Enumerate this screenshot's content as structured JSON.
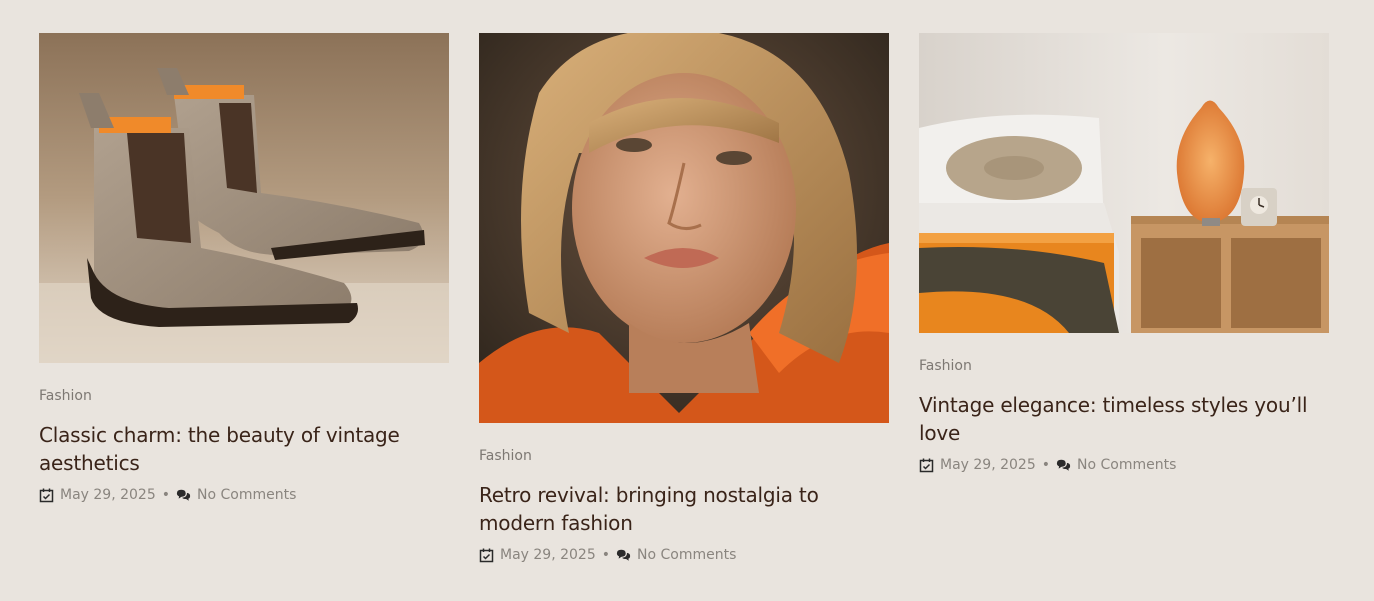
{
  "posts": [
    {
      "image": "suede chelsea boots on carpet",
      "category": "Fashion",
      "title": "Classic charm: the beauty of vintage aesthetics",
      "date": "May 29, 2025",
      "separator": "•",
      "comments": "No Comments"
    },
    {
      "image": "portrait of woman with blonde hair in orange jacket",
      "category": "Fashion",
      "title": "Retro revival: bringing nostalgia to modern fashion",
      "date": "May 29, 2025",
      "separator": "•",
      "comments": "No Comments"
    },
    {
      "image": "bedroom with rattan lamp and nightstand",
      "category": "Fashion",
      "title": "Vintage elegance: timeless styles you’ll love",
      "date": "May 29, 2025",
      "separator": "•",
      "comments": "No Comments"
    }
  ],
  "colors": {
    "background": "#e9e4de",
    "title": "#3a2419",
    "meta": "#8a857f",
    "accent": "#e8731f"
  },
  "icons": {
    "date": "calendar-check-icon",
    "comments": "comments-icon"
  }
}
